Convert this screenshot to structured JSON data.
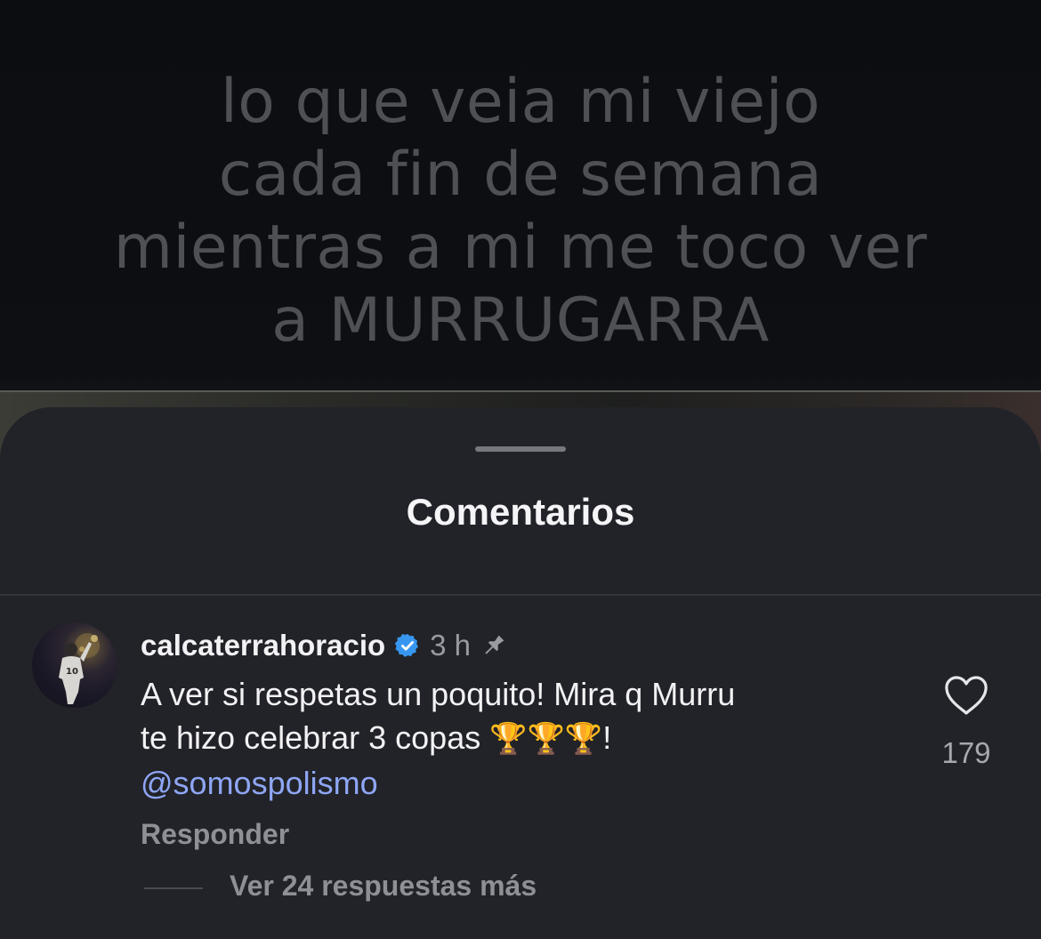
{
  "video": {
    "overlay_lines": [
      "lo que veia mi viejo",
      "cada fin de semana",
      "mientras a mi me toco ver",
      "a MURRUGARRA"
    ]
  },
  "sheet": {
    "title": "Comentarios"
  },
  "comment": {
    "username": "calcaterrahoracio",
    "timestamp": "3 h",
    "text_line1": "A ver si respetas un poquito! Mira q Murru",
    "text_line2": "te hizo celebrar 3 copas",
    "trophies": "🏆🏆🏆",
    "exclaim": "!",
    "mention": "@somospolismo",
    "like_count": "179",
    "reply_label": "Responder",
    "view_replies_label": "Ver 24 respuestas más"
  },
  "colors": {
    "sheet_bg": "#222328",
    "verified_blue": "#3797f0",
    "mention": "#8ea6f5"
  },
  "icons": {
    "verified": "verified-badge-icon",
    "pin": "pin-icon",
    "like": "heart-icon"
  }
}
